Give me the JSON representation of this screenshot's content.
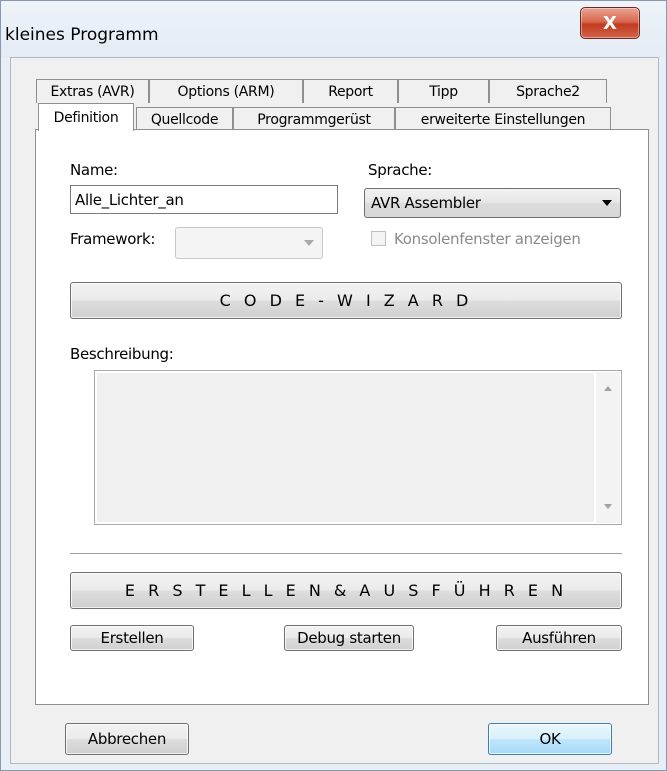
{
  "window": {
    "title": "kleines Programm",
    "close_glyph": "X"
  },
  "tabs_row1": [
    {
      "label": "Extras (AVR)"
    },
    {
      "label": "Options (ARM)"
    },
    {
      "label": "Report"
    },
    {
      "label": "Tipp"
    },
    {
      "label": "Sprache2"
    }
  ],
  "tabs_row2": [
    {
      "label": "Definition",
      "active": true
    },
    {
      "label": "Quellcode"
    },
    {
      "label": "Programmgerüst"
    },
    {
      "label": "erweiterte Einstellungen"
    }
  ],
  "form": {
    "name_label": "Name:",
    "name_value": "Alle_Lichter_an",
    "language_label": "Sprache:",
    "language_value": "AVR Assembler",
    "framework_label": "Framework:",
    "framework_value": "",
    "console_label": "Konsolenfenster anzeigen",
    "wizard_button": "C O D E - W I Z A R D",
    "description_label": "Beschreibung:",
    "description_value": ""
  },
  "actions": {
    "build_run": "E R S T E L L E N & A U S F Ü H R E N",
    "build": "Erstellen",
    "debug": "Debug starten",
    "run": "Ausführen"
  },
  "footer": {
    "cancel": "Abbrechen",
    "ok": "OK"
  },
  "colors": {
    "accent": "#3c7fb1",
    "close_red": "#c23b1f"
  }
}
